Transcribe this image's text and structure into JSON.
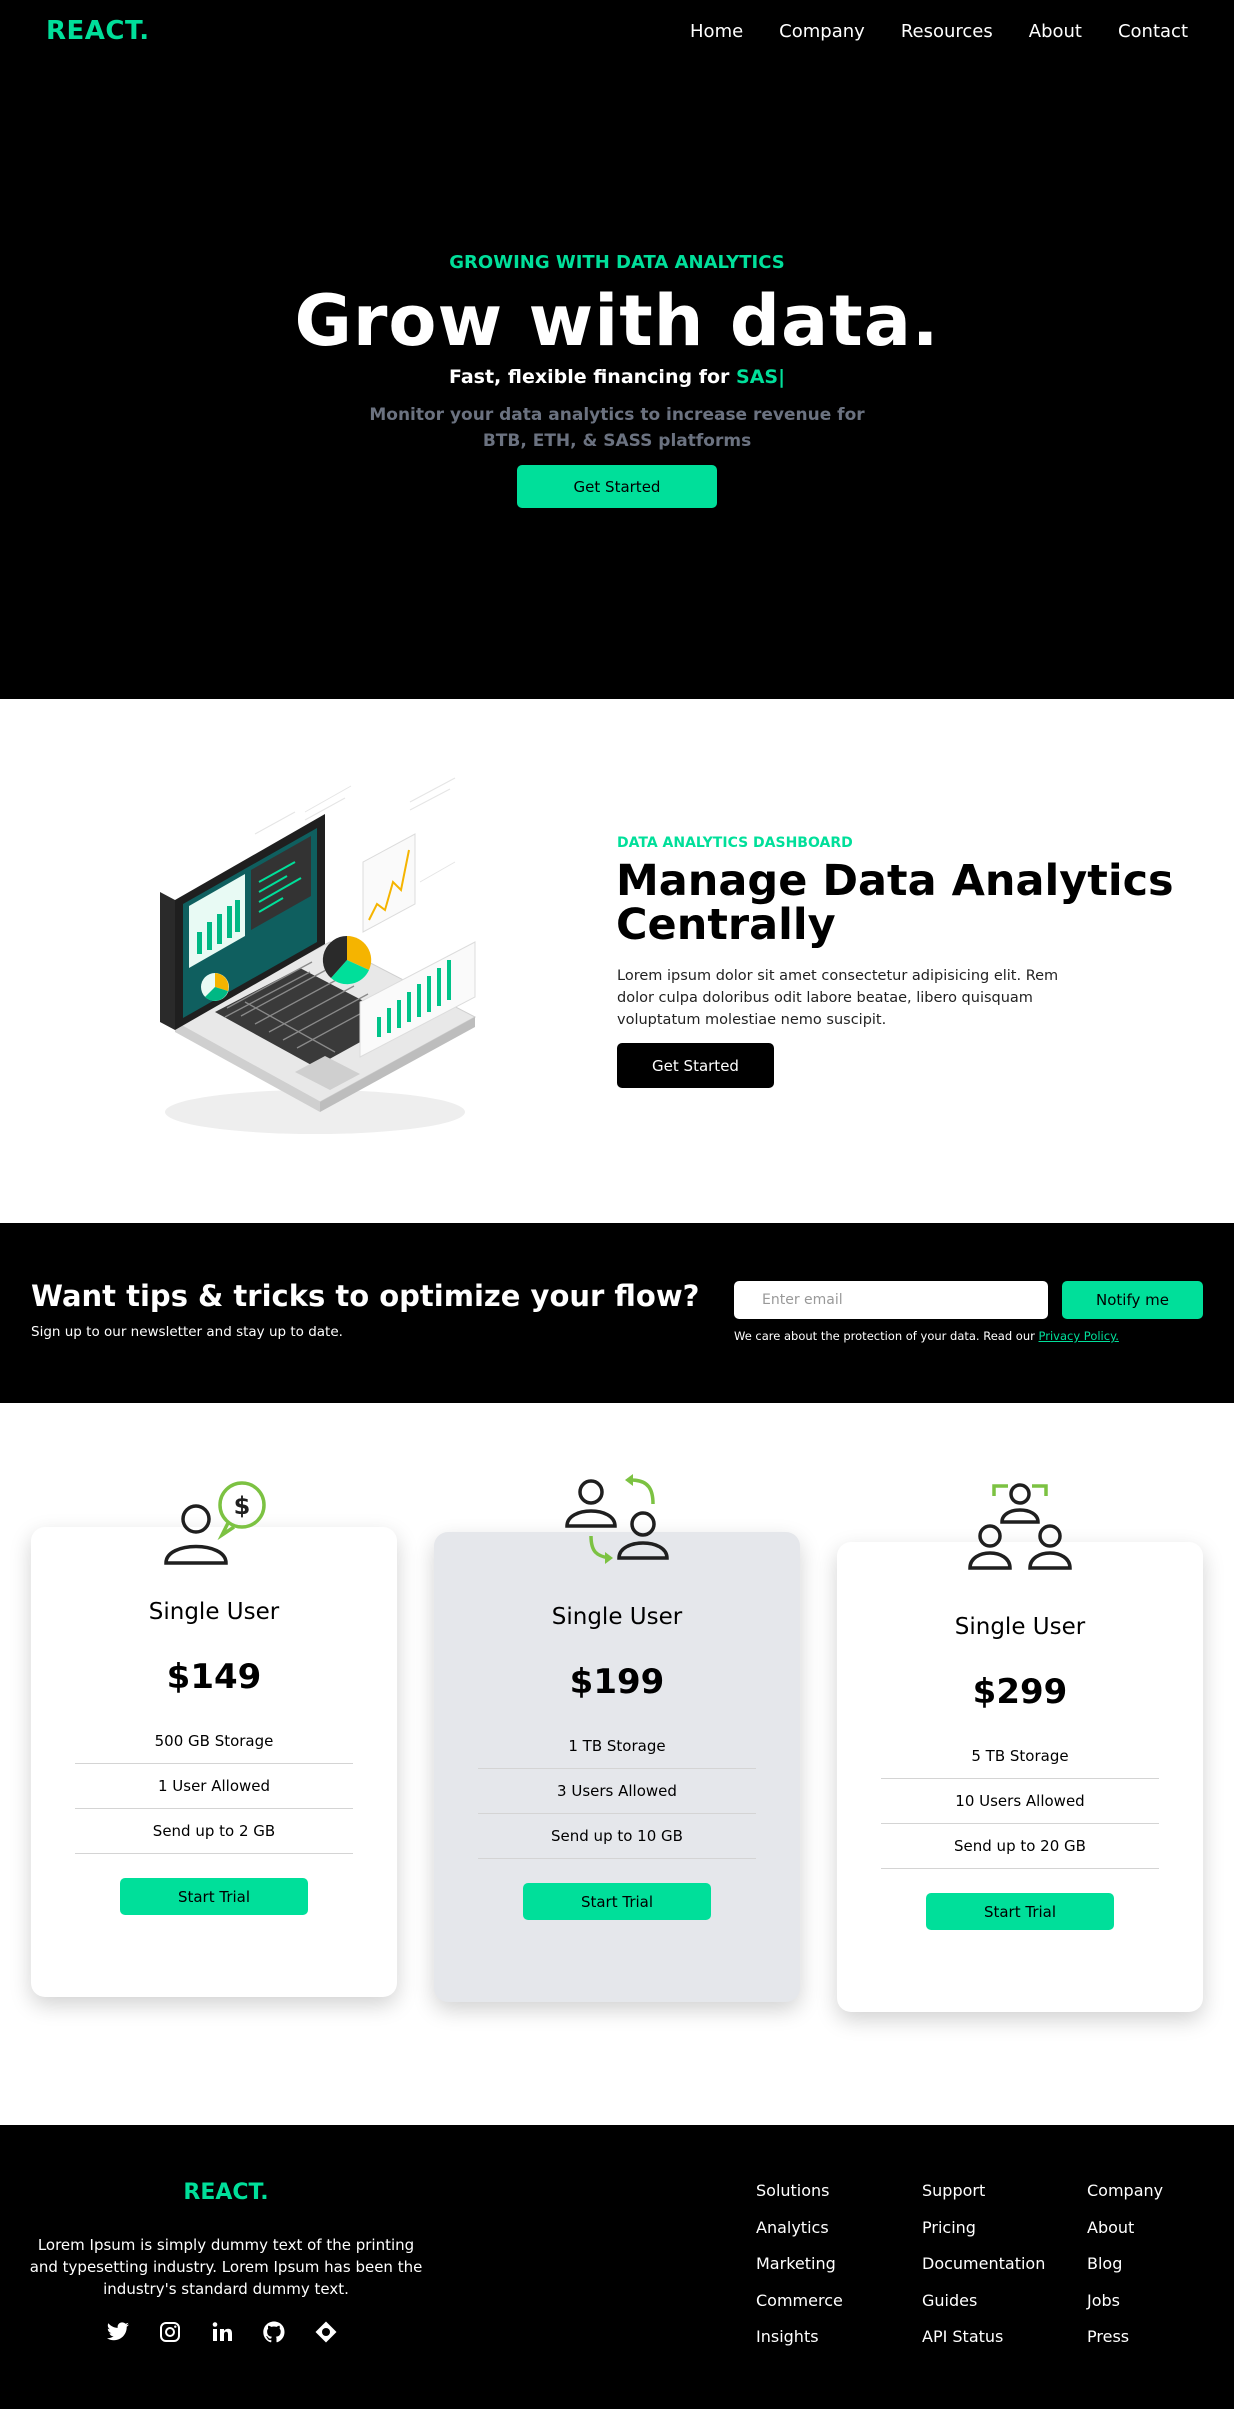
{
  "nav": {
    "brand": "REACT.",
    "links": [
      "Home",
      "Company",
      "Resources",
      "About",
      "Contact"
    ]
  },
  "hero": {
    "eyebrow": "GROWING WITH DATA ANALYTICS",
    "title": "Grow with data.",
    "subtitle_prefix": "Fast, flexible financing for",
    "subtitle_accent": "SAS|",
    "description": "Monitor your data analytics to increase revenue for BTB, ETH, & SASS platforms",
    "button": "Get Started"
  },
  "analytics": {
    "eyebrow": "DATA ANALYTICS DASHBOARD",
    "title": "Manage Data Analytics Centrally",
    "description": "Lorem ipsum dolor sit amet consectetur adipisicing elit. Rem dolor culpa doloribus odit labore beatae, libero quisquam voluptatum molestiae nemo suscipit.",
    "button": "Get Started"
  },
  "newsletter": {
    "title": "Want tips & tricks to optimize your flow?",
    "subtitle": "Sign up to our newsletter and stay up to date.",
    "placeholder": "Enter email",
    "button": "Notify me",
    "note": "We care about the protection of your data. Read our",
    "note_link": "Privacy Policy."
  },
  "pricing": [
    {
      "icon": "user-dollar-icon",
      "name": "Single User",
      "price": "$149",
      "features": [
        "500 GB Storage",
        "1 User Allowed",
        "Send up to 2 GB"
      ],
      "button": "Start Trial"
    },
    {
      "icon": "users-transfer-icon",
      "name": "Single User",
      "price": "$199",
      "features": [
        "1 TB Storage",
        "3 Users Allowed",
        "Send up to 10 GB"
      ],
      "button": "Start Trial"
    },
    {
      "icon": "team-icon",
      "name": "Single User",
      "price": "$299",
      "features": [
        "5 TB Storage",
        "10 Users Allowed",
        "Send up to 20 GB"
      ],
      "button": "Start Trial"
    }
  ],
  "footer": {
    "brand": "REACT.",
    "description": "Lorem Ipsum is simply dummy text of the printing and typesetting industry. Lorem Ipsum has been the industry's standard dummy text.",
    "socials": [
      "twitter-icon",
      "instagram-icon",
      "linkedin-icon",
      "github-icon",
      "dribbble-icon"
    ],
    "columns": [
      [
        "Solutions",
        "Analytics",
        "Marketing",
        "Commerce",
        "Insights"
      ],
      [
        "Support",
        "Pricing",
        "Documentation",
        "Guides",
        "API Status"
      ],
      [
        "Company",
        "About",
        "Blog",
        "Jobs",
        "Press"
      ]
    ]
  },
  "colors": {
    "accent": "#00df9a",
    "dark": "#000000",
    "muted": "#6b7280",
    "featured_card": "#e5e7eb"
  }
}
